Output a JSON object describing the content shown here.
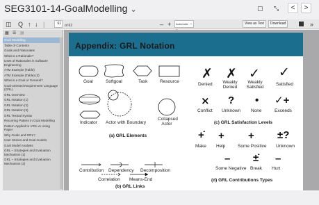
{
  "window": {
    "title": "SEG3101-14-GoalModelling",
    "title_chevron": "⌄",
    "btn_square": "▢",
    "btn_expand": "⤡",
    "btn_prev": "<",
    "btn_next": ">"
  },
  "toolbar": {
    "sidebar_toggle": "◫",
    "search": "Q",
    "up": "↑",
    "down": "↓",
    "separator": "|",
    "page_value": "61",
    "page_total": "of 62",
    "zoom_minus": "–",
    "zoom_plus": "+",
    "zoom_value": "Automatic Zoom",
    "zoom_chev": "⌄",
    "view_text": "View as Text",
    "download": "Download",
    "more": "»"
  },
  "sidebar": {
    "tool_thumbs": "▦",
    "tool_outline": "☰",
    "tool_attach": "▤",
    "items": [
      "Goal Modelling",
      "Table of Contents",
      "Goals and Rationales",
      "What is a Rationale?",
      "Uses of Rationales in Software Engineering",
      "ATM Example (Table)",
      "ATM Example (Table) (2)",
      "What is a Goal or General?",
      "Goal-oriented Requirement Language (GRL)",
      "GRL Overview",
      "GRL Notation (1)",
      "GRL Notation (2)",
      "GRL Notation (3)",
      "GRL Textual Syntax",
      "Recurring Pattern in Goal Modelling",
      "Pattern Applied to VRS vs Using Paper",
      "Why Goals and GRL?",
      "User Stories and Goal models",
      "Goal Model Analysis",
      "GRL – Strategies and Evaluation Mechanism (1)",
      "GRL – Strategies and Evaluation Mechanism (2)"
    ]
  },
  "slide": {
    "title": "Appendix: GRL Notation",
    "elements": {
      "goal": "Goal",
      "softgoal": "Softgoal",
      "task": "Task",
      "resource": "Resource",
      "belief": "Belief",
      "indicator": "Indicator",
      "actor_boundary": "Actor with Boundary",
      "collapsed_actor": "Collapsed Actor",
      "caption": "(a) GRL Elements"
    },
    "satisfaction": {
      "denied": "Denied",
      "weakly_denied": "Weakly Denied",
      "weakly_satisfied": "Weakly Satisfied",
      "satisfied": "Satisfied",
      "conflict": "Conflict",
      "unknown": "Unknown",
      "none": "None",
      "exceeds": "Exceeds",
      "caption": "(c) GRL Satisfaction Levels",
      "sym_denied": "✗",
      "sym_weakly_denied": "✗",
      "sym_weakly_satisfied": "✓",
      "sym_satisfied": "✓",
      "sym_conflict": "⨯",
      "sym_unknown": "?",
      "sym_none": "•",
      "sym_exceeds": "✓+"
    },
    "links": {
      "contribution": "Contribution",
      "dependency": "Dependency",
      "decomposition": "Decomposition",
      "correlation": "Correlation",
      "means_end": "Means-End",
      "caption": "(b) GRL Links"
    },
    "contributions": {
      "make": "Make",
      "help": "Help",
      "some_positive": "Some Positive",
      "unknown": "Unknown",
      "some_negative": "Some Negative",
      "break": "Break",
      "hurt": "Hurt",
      "caption": "(d) GRL Contributions Types",
      "sym_make": "+̇",
      "sym_help": "+",
      "sym_some_positive": "+",
      "sym_unknown": "±?",
      "sym_some_negative": "–",
      "sym_break": "±̇",
      "sym_hurt": "–"
    }
  }
}
